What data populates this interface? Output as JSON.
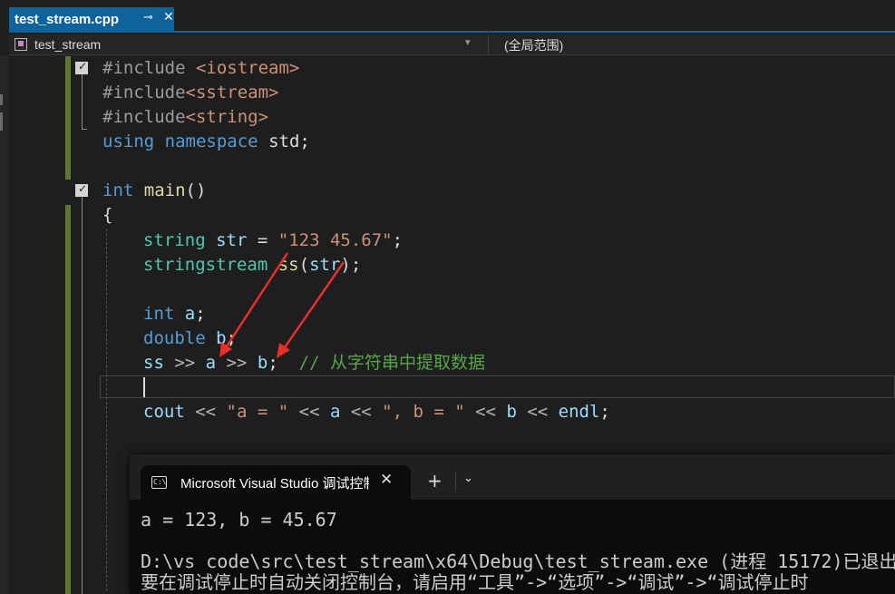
{
  "tab": {
    "title": "test_stream.cpp",
    "pin_glyph": "⊸",
    "close_glyph": "✕"
  },
  "navbar": {
    "project": "test_stream",
    "scope": "(全局范围)",
    "dropdown_glyph": "▾"
  },
  "code": {
    "l1": {
      "directive": "#include ",
      "header": "<iostream>"
    },
    "l2": {
      "directive": "#include",
      "header": "<sstream>"
    },
    "l3": {
      "directive": "#include",
      "header": "<string>"
    },
    "l4": {
      "kw1": "using",
      "kw2": "namespace",
      "ns": "std",
      "semi": ";"
    },
    "l6": {
      "type": "int",
      "func": "main",
      "parens": "()"
    },
    "l7": {
      "brace": "{"
    },
    "l8": {
      "type": "string",
      "var": "str",
      "eq": " = ",
      "literal": "\"123 45.67\"",
      "semi": ";"
    },
    "l9": {
      "type": "stringstream",
      "var": "ss",
      "open": "(",
      "arg": "str",
      "close": ");"
    },
    "l11": {
      "type": "int",
      "var": "a",
      "semi": ";"
    },
    "l12": {
      "type": "double",
      "var": "b",
      "semi": ";"
    },
    "l13": {
      "var1": "ss",
      "op1": " >> ",
      "var2": "a",
      "op2": " >> ",
      "var3": "b",
      "semi": ";",
      "comment": "  // 从字符串中提取数据"
    },
    "l15": {
      "var1": "cout",
      "op1": " << ",
      "s1": "\"a = \"",
      "op2": " << ",
      "v2": "a",
      "op3": " << ",
      "s2": "\", b = \"",
      "op4": " << ",
      "v3": "b",
      "op5": " << ",
      "v4": "endl",
      "semi": ";"
    }
  },
  "console": {
    "tab_icon": "C:\\",
    "tab_title": "Microsoft Visual Studio 调试控制台",
    "close_glyph": "✕",
    "new_tab_glyph": "+",
    "dropdown_glyph": "⌄",
    "output": [
      "a = 123, b = 45.67",
      "",
      "D:\\vs code\\src\\test_stream\\x64\\Debug\\test_stream.exe (进程 15172)已退出",
      "要在调试停止时自动关闭控制台，请启用“工具”->“选项”->“调试”->“调试停止时"
    ]
  },
  "colors": {
    "accent": "#0e639c",
    "keyword": "#569cd6",
    "type": "#4ec9b0",
    "string": "#ce9178",
    "function": "#dcdcaa",
    "variable": "#9cdcfe",
    "comment": "#57a64a",
    "change_bar": "#5a7a2f",
    "annotation_arrow": "#e8302a"
  }
}
